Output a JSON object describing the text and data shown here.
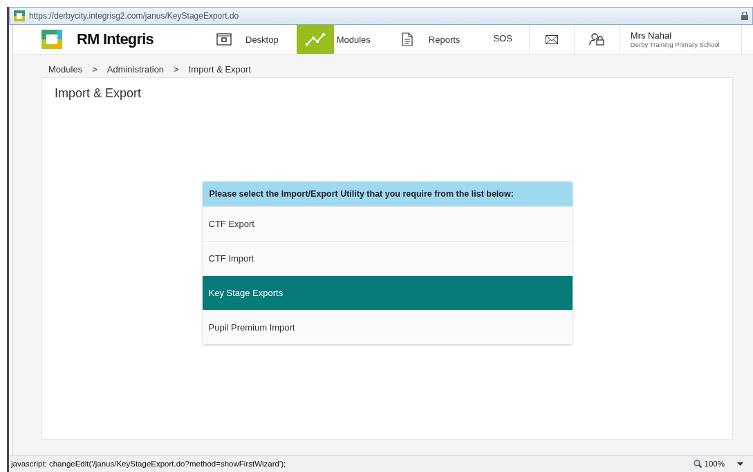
{
  "address_bar": {
    "url": "https://derbycity.integrisg2.com/janus/KeyStageExport.do"
  },
  "header": {
    "brand": "RM Integris",
    "nav": [
      {
        "label": "Desktop",
        "selected": false
      },
      {
        "label": "Modules",
        "selected": true
      },
      {
        "label": "Reports",
        "selected": false
      },
      {
        "label": "SOS",
        "selected": false
      }
    ],
    "user": {
      "name": "Mrs Nahal",
      "school": "Derby Training Primary School"
    }
  },
  "breadcrumb": [
    "Modules",
    "Administration",
    "Import & Export"
  ],
  "breadcrumb_separator": ">",
  "page_title": "Import & Export",
  "utility_list": {
    "heading": "Please select the Import/Export Utility that you require from the list below:",
    "items": [
      {
        "label": "CTF Export",
        "selected": false
      },
      {
        "label": "CTF Import",
        "selected": false
      },
      {
        "label": "Key Stage Exports",
        "selected": true
      },
      {
        "label": "Pupil Premium Import",
        "selected": false
      }
    ]
  },
  "status_bar": {
    "text": "javascript: changeEdit('/janus/KeyStageExport.do?method=showFirstWizard');",
    "zoom": "100%"
  }
}
